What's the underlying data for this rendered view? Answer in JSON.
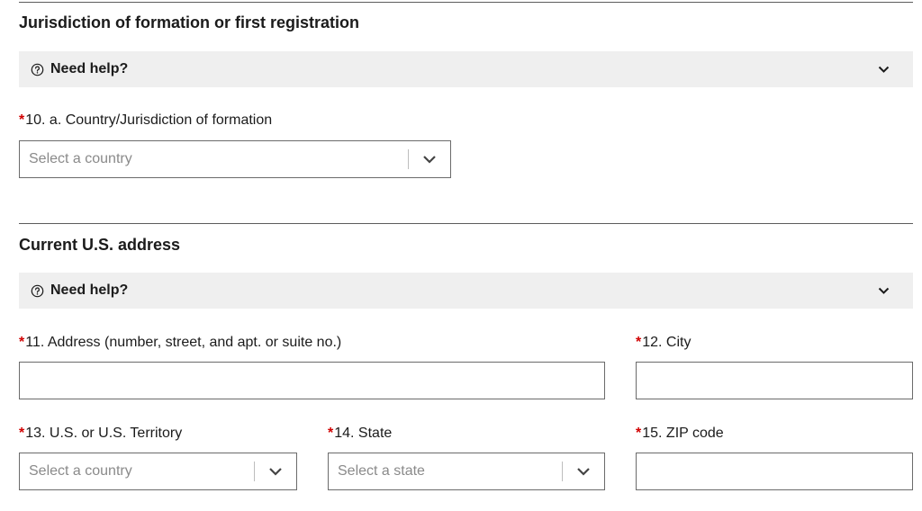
{
  "section1": {
    "title": "Jurisdiction of formation or first registration",
    "help": "Need help?",
    "field10": {
      "req": "*",
      "label": "10. a. Country/Jurisdiction of formation",
      "placeholder": "Select a country"
    }
  },
  "section2": {
    "title": "Current U.S. address",
    "help": "Need help?",
    "field11": {
      "req": "*",
      "label": "11. Address (number, street, and apt. or suite no.)"
    },
    "field12": {
      "req": "*",
      "label": "12. City"
    },
    "field13": {
      "req": "*",
      "label": "13. U.S. or U.S. Territory",
      "placeholder": "Select a country"
    },
    "field14": {
      "req": "*",
      "label": "14. State",
      "placeholder": "Select a state"
    },
    "field15": {
      "req": "*",
      "label": "15. ZIP code"
    }
  },
  "icons": {
    "help": "question-circle-icon",
    "expand": "chevron-down-icon"
  },
  "colors": {
    "required": "#d10000",
    "help_bg": "#efefef"
  }
}
